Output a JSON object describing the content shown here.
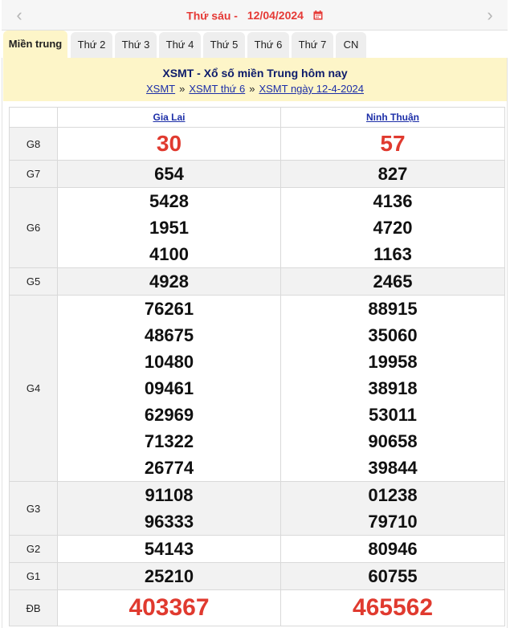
{
  "datebar": {
    "day_label": "Thứ sáu -",
    "date": "12/04/2024",
    "prev_icon": "chevron-left-icon",
    "next_icon": "chevron-right-icon",
    "calendar_icon": "calendar-icon"
  },
  "tabs": [
    "Miền trung",
    "Thứ 2",
    "Thứ 3",
    "Thứ 4",
    "Thứ 5",
    "Thứ 6",
    "Thứ 7",
    "CN"
  ],
  "header": {
    "title": "XSMT - Xổ số miền Trung hôm nay",
    "breadcrumbs": [
      "XSMT",
      "XSMT thứ 6",
      "XSMT ngày 12-4-2024"
    ],
    "separator": "»"
  },
  "table": {
    "columns": [
      "Gia Lai",
      "Ninh Thuận"
    ],
    "rows": [
      {
        "label": "G8",
        "values": [
          [
            "30"
          ],
          [
            "57"
          ]
        ]
      },
      {
        "label": "G7",
        "values": [
          [
            "654"
          ],
          [
            "827"
          ]
        ]
      },
      {
        "label": "G6",
        "values": [
          [
            "5428",
            "1951",
            "4100"
          ],
          [
            "4136",
            "4720",
            "1163"
          ]
        ]
      },
      {
        "label": "G5",
        "values": [
          [
            "4928"
          ],
          [
            "2465"
          ]
        ]
      },
      {
        "label": "G4",
        "values": [
          [
            "76261",
            "48675",
            "10480",
            "09461",
            "62969",
            "71322",
            "26774"
          ],
          [
            "88915",
            "35060",
            "19958",
            "38918",
            "53011",
            "90658",
            "39844"
          ]
        ]
      },
      {
        "label": "G3",
        "values": [
          [
            "91108",
            "96333"
          ],
          [
            "01238",
            "79710"
          ]
        ]
      },
      {
        "label": "G2",
        "values": [
          [
            "54143"
          ],
          [
            "80946"
          ]
        ]
      },
      {
        "label": "G1",
        "values": [
          [
            "25210"
          ],
          [
            "60755"
          ]
        ]
      },
      {
        "label": "ĐB",
        "values": [
          [
            "403367"
          ],
          [
            "465562"
          ]
        ]
      }
    ]
  },
  "colors": {
    "accent_red": "#e03a2f",
    "link_blue": "#1d2fa8",
    "header_bg": "#fdf5c8"
  }
}
